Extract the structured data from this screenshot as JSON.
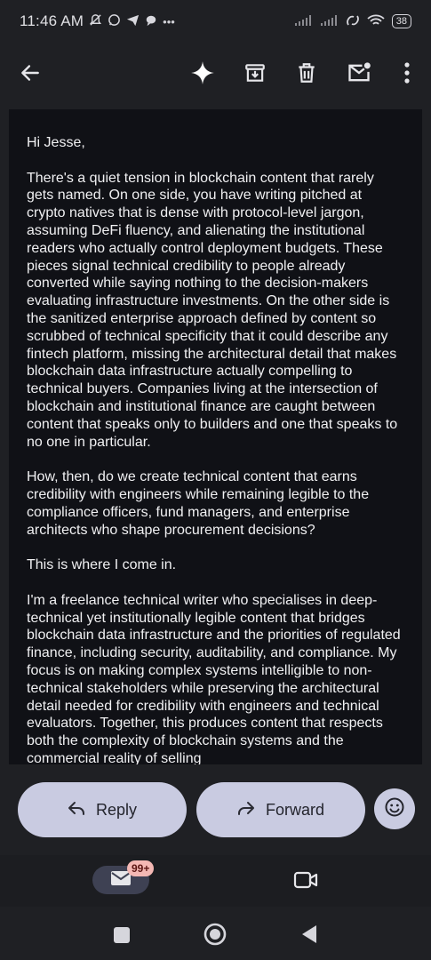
{
  "status_bar": {
    "time": "11:46 AM",
    "left_icons": [
      "mute-icon",
      "whatsapp-icon",
      "telegram-icon",
      "chat-icon",
      "more-dots"
    ],
    "right_icons": [
      "signal-icon",
      "signal-icon",
      "data-icon",
      "wifi-icon"
    ],
    "more_dots": "•••",
    "battery": "38"
  },
  "toolbar": {
    "icons": [
      "back-arrow-icon",
      "sparkle-icon",
      "archive-icon",
      "delete-icon",
      "mark-unread-icon",
      "more-vert-icon"
    ]
  },
  "email": {
    "paragraphs": [
      "Hi Jesse,",
      "There's a quiet tension in blockchain content that rarely gets named. On one side, you have writing pitched at crypto natives that is dense with protocol-level jargon, assuming DeFi fluency, and alienating the institutional readers who actually control deployment budgets. These pieces signal technical credibility to people already converted while saying nothing to the decision-makers evaluating infrastructure investments. On the other side is the sanitized enterprise approach defined by content so scrubbed of technical specificity that it could describe any fintech platform, missing the architectural detail that makes blockchain data infrastructure actually compelling to technical buyers. Companies living at the intersection of blockchain and institutional finance are caught between content that speaks only to builders and one that speaks to no one in particular.",
      "How, then, do we create technical content that earns credibility with engineers while remaining legible to the compliance officers, fund managers, and enterprise architects who shape procurement decisions?",
      "This is where I come in.",
      "I'm a freelance technical writer who specialises in deep-technical yet institutionally legible content that bridges blockchain data infrastructure and the priorities of regulated finance, including security, auditability, and compliance. My focus is on making complex systems intelligible to non-technical stakeholders while preserving the architectural detail needed for credibility with engineers and technical evaluators. Together, this produces content that respects both the complexity of blockchain systems and the commercial reality of selling"
    ]
  },
  "actions": {
    "reply_label": "Reply",
    "forward_label": "Forward"
  },
  "bottom_nav": {
    "mail_badge": "99+"
  },
  "colors": {
    "background": "#1f2024",
    "card": "#101116",
    "button": "#c9cbe1",
    "badge": "#f4b8b4"
  }
}
